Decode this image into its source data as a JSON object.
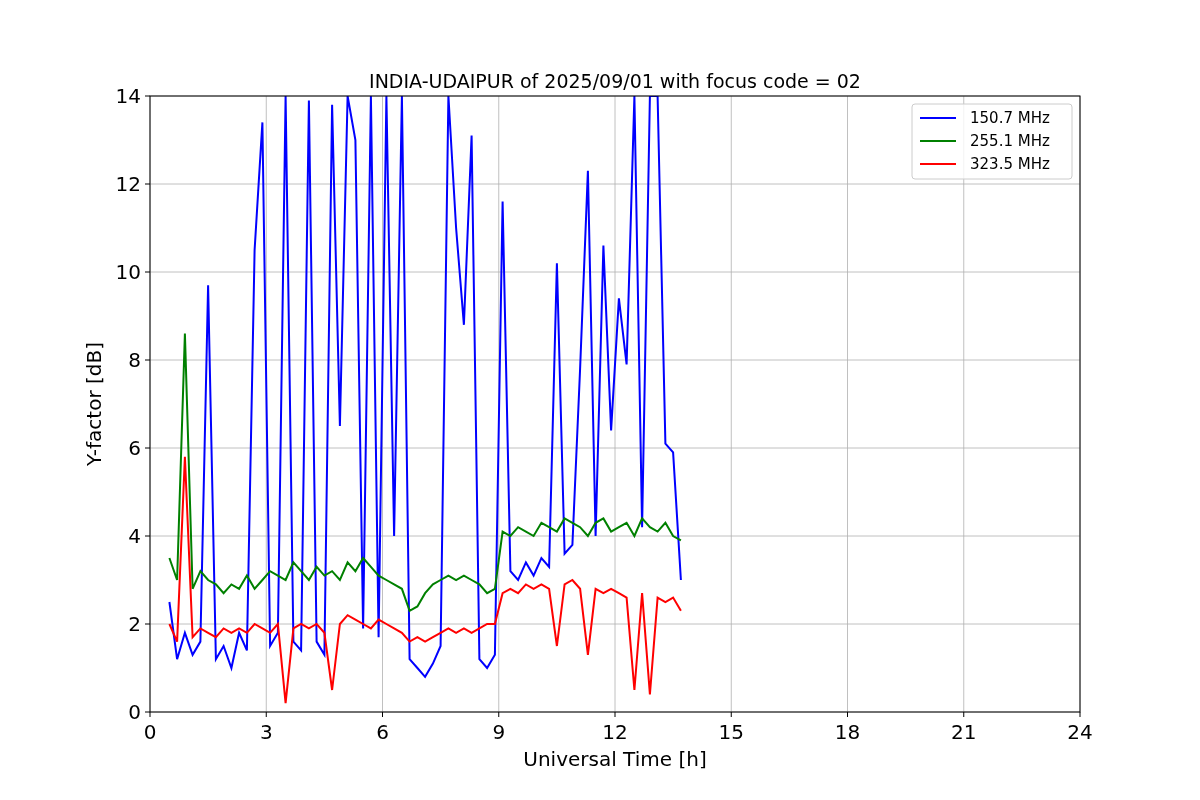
{
  "chart_data": {
    "type": "line",
    "title": "INDIA-UDAIPUR of 2025/09/01 with focus code = 02",
    "xlabel": "Universal Time [h]",
    "ylabel": "Y-factor [dB]",
    "xlim": [
      0,
      24
    ],
    "ylim": [
      0,
      14
    ],
    "xticks": [
      0,
      3,
      6,
      9,
      12,
      15,
      18,
      21,
      24
    ],
    "yticks": [
      0,
      2,
      4,
      6,
      8,
      10,
      12,
      14
    ],
    "grid": true,
    "legend": true,
    "x": [
      0.5,
      0.7,
      0.9,
      1.1,
      1.3,
      1.5,
      1.7,
      1.9,
      2.1,
      2.3,
      2.5,
      2.7,
      2.9,
      3.1,
      3.3,
      3.5,
      3.7,
      3.9,
      4.1,
      4.3,
      4.5,
      4.7,
      4.9,
      5.1,
      5.3,
      5.5,
      5.7,
      5.9,
      6.1,
      6.3,
      6.5,
      6.7,
      6.9,
      7.1,
      7.3,
      7.5,
      7.7,
      7.9,
      8.1,
      8.3,
      8.5,
      8.7,
      8.9,
      9.1,
      9.3,
      9.5,
      9.7,
      9.9,
      10.1,
      10.3,
      10.5,
      10.7,
      10.9,
      11.1,
      11.3,
      11.5,
      11.7,
      11.9,
      12.1,
      12.3,
      12.5,
      12.7,
      12.9,
      13.1,
      13.3,
      13.5,
      13.7
    ],
    "series": [
      {
        "name": "150.7 MHz",
        "color": "#0000ff",
        "values": [
          2.5,
          1.2,
          1.8,
          1.3,
          1.6,
          9.7,
          1.2,
          1.5,
          1.0,
          1.8,
          1.4,
          10.5,
          13.4,
          1.5,
          1.8,
          14,
          1.6,
          1.4,
          13.9,
          1.6,
          1.3,
          13.8,
          6.5,
          14,
          13,
          1.9,
          14,
          1.7,
          14,
          4.0,
          14,
          1.2,
          1.0,
          0.8,
          1.1,
          1.5,
          14,
          11,
          8.8,
          13.1,
          1.2,
          1.0,
          1.3,
          11.6,
          3.2,
          3.0,
          3.4,
          3.1,
          3.5,
          3.3,
          10.2,
          3.6,
          3.8,
          7.8,
          12.3,
          4.0,
          10.6,
          6.4,
          9.4,
          7.9,
          14,
          4.2,
          14,
          14,
          6.1,
          5.9,
          3.0
        ]
      },
      {
        "name": "255.1 MHz",
        "color": "#008000",
        "values": [
          3.5,
          3.0,
          8.6,
          2.8,
          3.2,
          3.0,
          2.9,
          2.7,
          2.9,
          2.8,
          3.1,
          2.8,
          3.0,
          3.2,
          3.1,
          3.0,
          3.4,
          3.2,
          3.0,
          3.3,
          3.1,
          3.2,
          3.0,
          3.4,
          3.2,
          3.5,
          3.3,
          3.1,
          3.0,
          2.9,
          2.8,
          2.3,
          2.4,
          2.7,
          2.9,
          3.0,
          3.1,
          3.0,
          3.1,
          3.0,
          2.9,
          2.7,
          2.8,
          4.1,
          4.0,
          4.2,
          4.1,
          4.0,
          4.3,
          4.2,
          4.1,
          4.4,
          4.3,
          4.2,
          4.0,
          4.3,
          4.4,
          4.1,
          4.2,
          4.3,
          4.0,
          4.4,
          4.2,
          4.1,
          4.3,
          4.0,
          3.9
        ]
      },
      {
        "name": "323.5 MHz",
        "color": "#ff0000",
        "values": [
          2.0,
          1.6,
          5.8,
          1.7,
          1.9,
          1.8,
          1.7,
          1.9,
          1.8,
          1.9,
          1.8,
          2.0,
          1.9,
          1.8,
          2.0,
          0.2,
          1.9,
          2.0,
          1.9,
          2.0,
          1.8,
          0.5,
          2.0,
          2.2,
          2.1,
          2.0,
          1.9,
          2.1,
          2.0,
          1.9,
          1.8,
          1.6,
          1.7,
          1.6,
          1.7,
          1.8,
          1.9,
          1.8,
          1.9,
          1.8,
          1.9,
          2.0,
          2.0,
          2.7,
          2.8,
          2.7,
          2.9,
          2.8,
          2.9,
          2.8,
          1.5,
          2.9,
          3.0,
          2.8,
          1.3,
          2.8,
          2.7,
          2.8,
          2.7,
          2.6,
          0.5,
          2.7,
          0.4,
          2.6,
          2.5,
          2.6,
          2.3
        ]
      }
    ]
  }
}
